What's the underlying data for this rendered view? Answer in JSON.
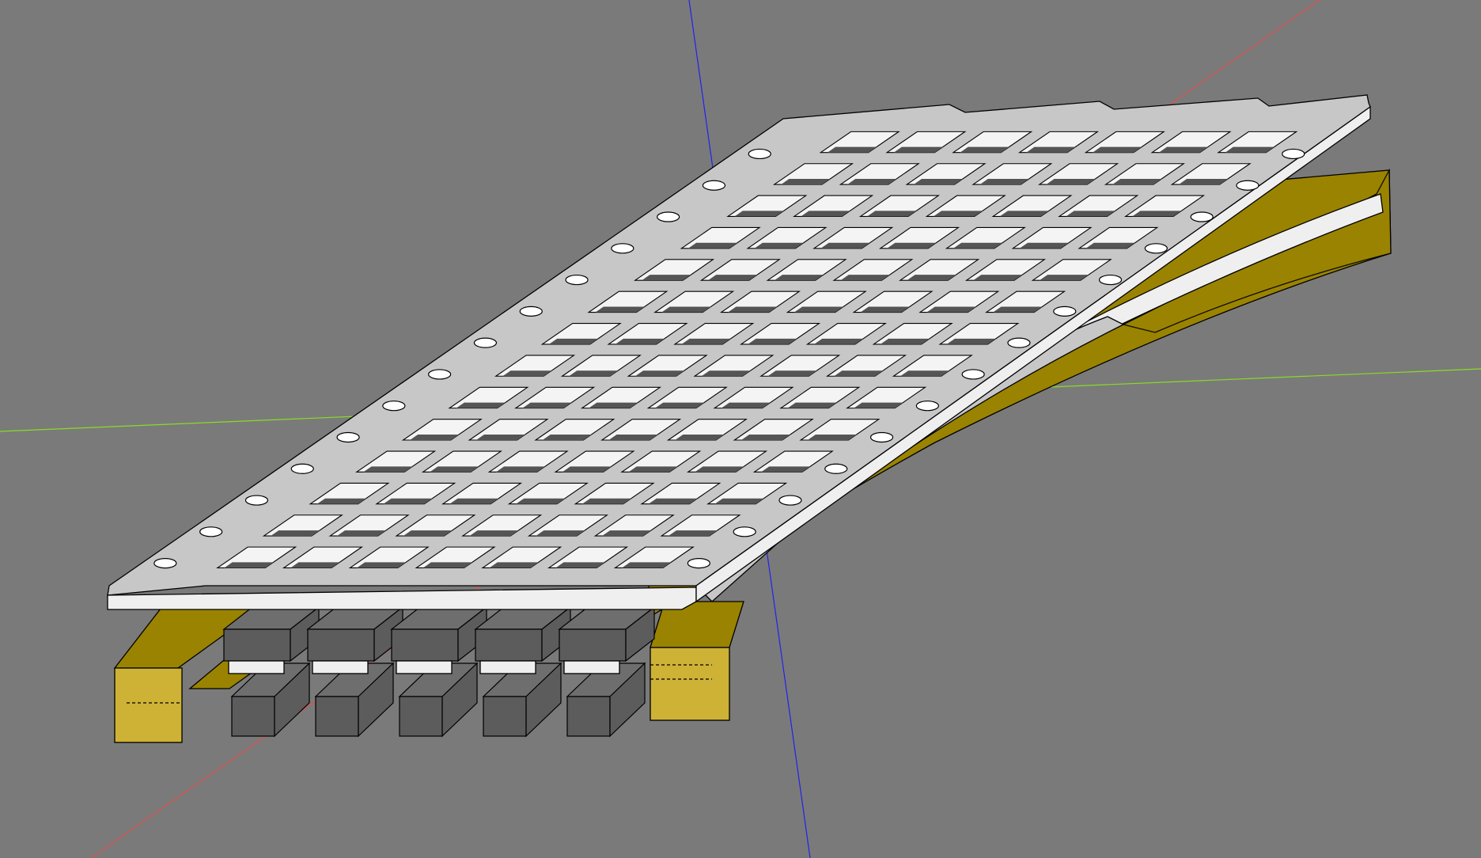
{
  "viewport": {
    "background_color": "#7a7a7a"
  },
  "axes": {
    "x_axis_color": "#e05050",
    "y_axis_color": "#88dd22",
    "z_axis_color": "#2222ee"
  },
  "model": {
    "keyplate_color": "#c7c7c7",
    "keyplate_side_color": "#efefef",
    "switch_socket_color": "#5c5c5c",
    "bracket_top_color": "#9a8300",
    "bracket_front_color": "#cdb236",
    "edge_color": "#000000",
    "key_grid": {
      "rows": 14,
      "columns": 7
    },
    "mount_holes_per_edge": 14,
    "switch_blocks_visible": 5
  }
}
